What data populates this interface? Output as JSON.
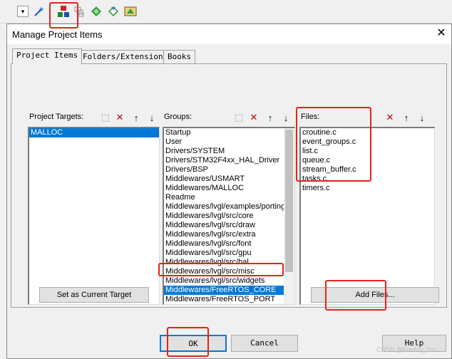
{
  "toolbar": {
    "icons": [
      "dropdown-arrow-icon",
      "magic-wand-icon",
      "manage-project-items-icon",
      "stack-icon",
      "diamond-icon",
      "download-diamond-icon",
      "pack-installer-icon"
    ]
  },
  "dialog": {
    "title": "Manage Project Items",
    "close_glyph": "✕",
    "tabs": [
      {
        "label": "Project Items"
      },
      {
        "label": "Folders/Extensions"
      },
      {
        "label": "Books"
      }
    ],
    "targets": {
      "label": "Project Targets:",
      "items": [
        "MALLOC"
      ],
      "selected": "MALLOC"
    },
    "groups": {
      "label": "Groups:",
      "items": [
        "Startup",
        "User",
        "Drivers/SYSTEM",
        "Drivers/STM32F4xx_HAL_Driver",
        "Drivers/BSP",
        "Middlewares/USMART",
        "Middlewares/MALLOC",
        "Readme",
        "Middlewares/lvgl/examples/porting",
        "Middlewares/lvgl/src/core",
        "Middlewares/lvgl/src/draw",
        "Middlewares/lvgl/src/extra",
        "Middlewares/lvgl/src/font",
        "Middlewares/lvgl/src/gpu",
        "Middlewares/lvgl/src/hal",
        "Middlewares/lvgl/src/misc",
        "Middlewares/lvgl/src/widgets",
        "Middlewares/FreeRTOS_CORE",
        "Middlewares/FreeRTOS_PORT"
      ],
      "selected": "Middlewares/FreeRTOS_CORE"
    },
    "files": {
      "label": "Files:",
      "items": [
        "croutine.c",
        "event_groups.c",
        "list.c",
        "queue.c",
        "stream_buffer.c",
        "tasks.c",
        "timers.c"
      ]
    },
    "buttons": {
      "set_current_target": "Set as Current Target",
      "add_files": "Add Files...",
      "ok": "OK",
      "cancel": "Cancel",
      "help": "Help"
    },
    "icon_glyphs": {
      "new": "⬚",
      "delete": "✕",
      "up": "↑",
      "down": "↓"
    }
  },
  "watermark": "CSDN @Freddy_Ssc",
  "colors": {
    "selection": "#0078d7",
    "highlight_box": "#e8211a",
    "delete_icon": "#c00000"
  }
}
